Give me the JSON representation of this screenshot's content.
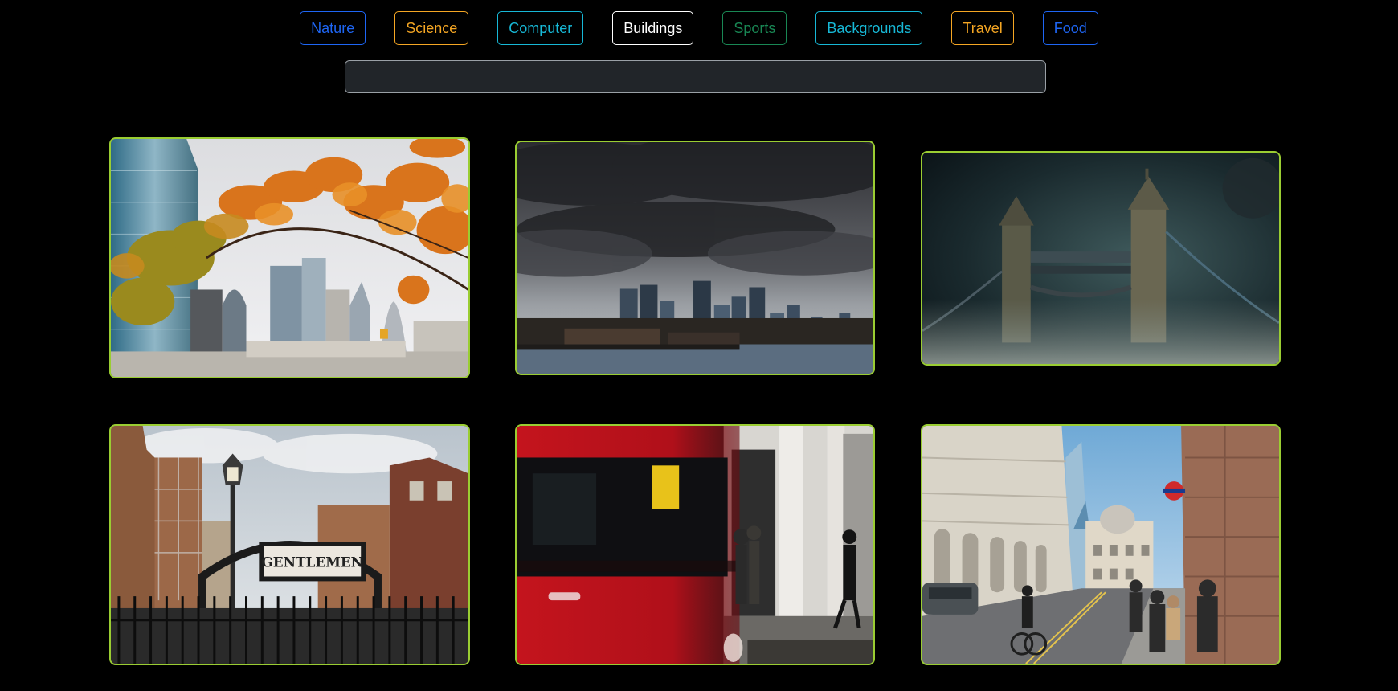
{
  "categories": [
    {
      "label": "Nature",
      "color": "#1e66f5"
    },
    {
      "label": "Science",
      "color": "#f5a623"
    },
    {
      "label": "Computer",
      "color": "#17b8d6"
    },
    {
      "label": "Buildings",
      "color": "#ffffff"
    },
    {
      "label": "Sports",
      "color": "#198754"
    },
    {
      "label": "Backgrounds",
      "color": "#17b8d6"
    },
    {
      "label": "Travel",
      "color": "#f5a623"
    },
    {
      "label": "Food",
      "color": "#1e66f5"
    }
  ],
  "search": {
    "value": "",
    "placeholder": ""
  },
  "theme": {
    "background": "#000000",
    "card_border": "#9acd32",
    "input_bg": "#212529"
  },
  "gallery": {
    "images": [
      {
        "subject": "autumn leaves framing city skyline"
      },
      {
        "subject": "storm clouds over city skyline by the river"
      },
      {
        "subject": "tower bridge at night in fog"
      },
      {
        "subject": "gentlemen toilet sign with iron railings",
        "sign_text": "GENTLEMEN"
      },
      {
        "subject": "motion-blurred red bus passing pedestrians"
      },
      {
        "subject": "city street with classical buildings and cyclist"
      }
    ]
  }
}
